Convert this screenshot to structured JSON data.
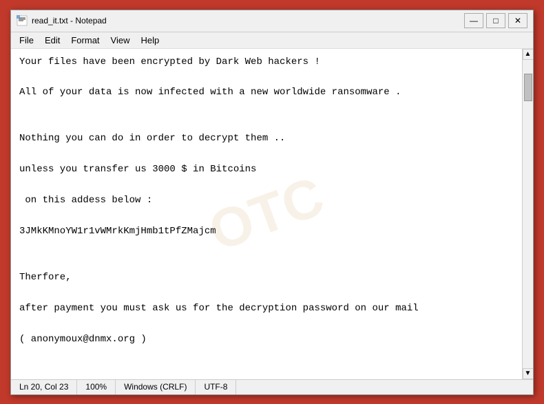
{
  "window": {
    "title": "read_it.txt - Notepad",
    "icon": "📄"
  },
  "titlebar": {
    "minimize_label": "—",
    "maximize_label": "□",
    "close_label": "✕"
  },
  "menubar": {
    "items": [
      "File",
      "Edit",
      "Format",
      "View",
      "Help"
    ]
  },
  "content": {
    "text": "Your files have been encrypted by Dark Web hackers !\n\nAll of your data is now infected with a new worldwide ransomware .\n\n\nNothing you can do in order to decrypt them ..\n\nunless you transfer us 3000 $ in Bitcoins\n\n on this addess below :\n\n3JMkKMnoYW1r1vWMrkKmjHmb1tPfZMajcm\n\n\nTherfore,\n\nafter payment you must ask us for the decryption password on our mail\n\n( anonymoux@dnmx.org )"
  },
  "statusbar": {
    "position": "Ln 20, Col 23",
    "zoom": "100%",
    "line_ending": "Windows (CRLF)",
    "encoding": "UTF-8"
  }
}
